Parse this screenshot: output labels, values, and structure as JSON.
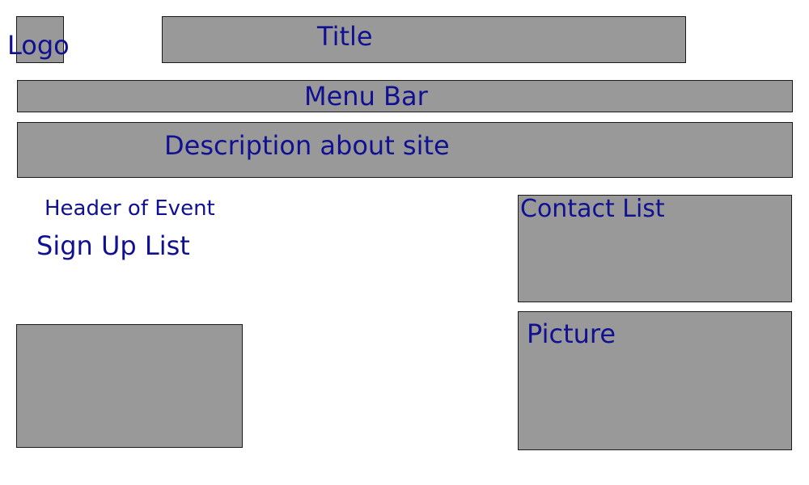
{
  "logo": {
    "label": "Logo"
  },
  "header": {
    "title": "Title"
  },
  "menu": {
    "label": "Menu Bar"
  },
  "description": {
    "label": "Description about site"
  },
  "event": {
    "header_label": "Header of Event",
    "signup_label": "Sign Up List"
  },
  "contact": {
    "label": "Contact List"
  },
  "picture": {
    "label": "Picture"
  },
  "colors": {
    "box_fill": "#999999",
    "box_border": "#1a1a1a",
    "text": "#101090"
  }
}
